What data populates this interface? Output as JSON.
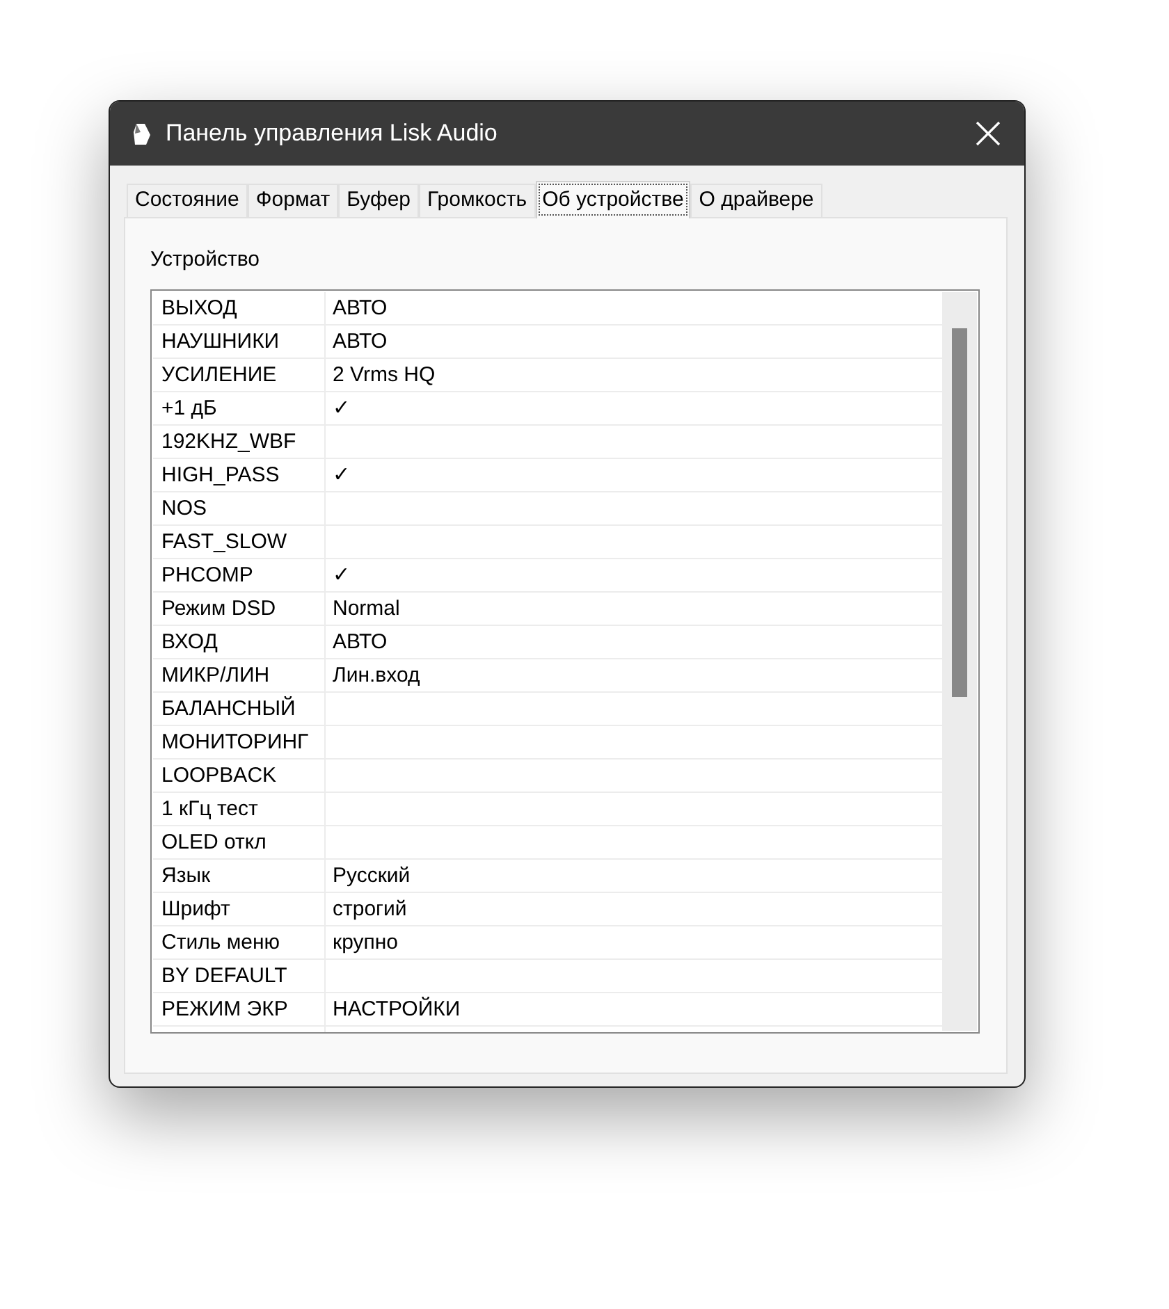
{
  "window": {
    "title": "Панель управления Lisk Audio"
  },
  "tabs": [
    {
      "label": "Состояние",
      "selected": false
    },
    {
      "label": "Формат",
      "selected": false
    },
    {
      "label": "Буфер",
      "selected": false
    },
    {
      "label": "Громкость",
      "selected": false
    },
    {
      "label": "Об устройстве",
      "selected": true
    },
    {
      "label": "О драйвере",
      "selected": false
    }
  ],
  "group": {
    "label": "Устройство"
  },
  "table": {
    "rows": [
      {
        "name": "ВЫХОД",
        "value": "АВТО"
      },
      {
        "name": "НАУШНИКИ",
        "value": "АВТО"
      },
      {
        "name": "УСИЛЕНИЕ",
        "value": "2 Vrms HQ"
      },
      {
        "name": "+1 дБ",
        "value": "✓"
      },
      {
        "name": "192KHZ_WBF"
      },
      {
        "name": "HIGH_PASS",
        "value": "✓"
      },
      {
        "name": "NOS"
      },
      {
        "name": "FAST_SLOW"
      },
      {
        "name": "PHCOMP",
        "value": "✓"
      },
      {
        "name": "Режим DSD",
        "value": "Normal"
      },
      {
        "name": "ВХОД",
        "value": "АВТО"
      },
      {
        "name": "МИКР/ЛИН",
        "value": "Лин.вход"
      },
      {
        "name": "БАЛАНСНЫЙ"
      },
      {
        "name": "МОНИТОРИНГ"
      },
      {
        "name": "LOOPBACK"
      },
      {
        "name": "1 кГц тест"
      },
      {
        "name": "OLED откл"
      },
      {
        "name": "Язык",
        "value": "Русский"
      },
      {
        "name": "Шрифт",
        "value": "строгий"
      },
      {
        "name": "Стиль меню",
        "value": "крупно"
      },
      {
        "name": "BY DEFAULT"
      },
      {
        "name": "РЕЖИМ ЭКР",
        "value": "НАСТРОЙКИ"
      }
    ]
  }
}
